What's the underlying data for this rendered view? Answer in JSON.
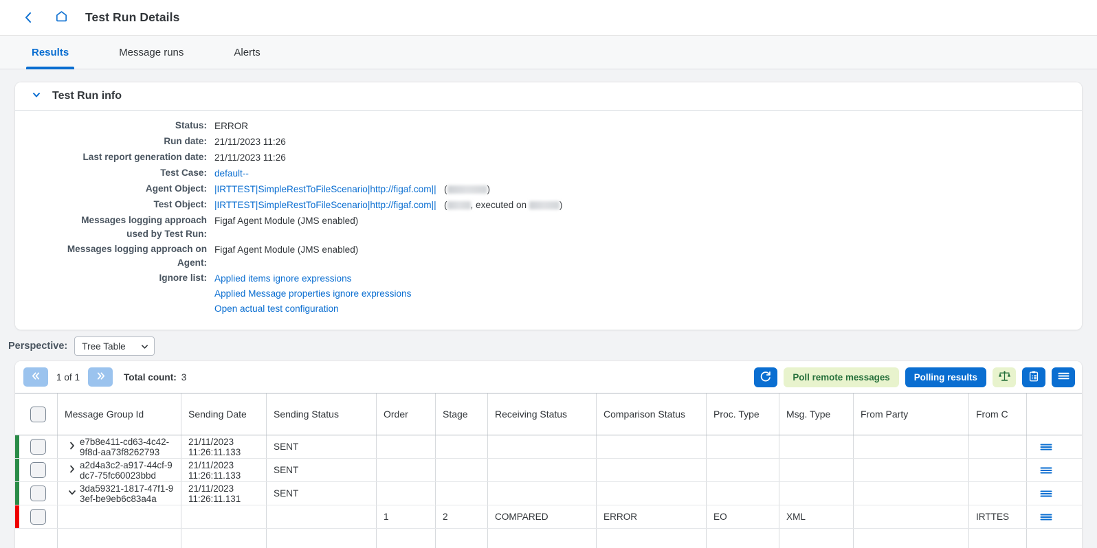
{
  "header": {
    "back_icon": "chevron-left-icon",
    "home_icon": "home-icon",
    "title": "Test Run Details"
  },
  "tabs": [
    {
      "label": "Results",
      "active": true
    },
    {
      "label": "Message runs",
      "active": false
    },
    {
      "label": "Alerts",
      "active": false
    }
  ],
  "info_panel": {
    "title": "Test Run info",
    "expanded": true,
    "rows": [
      {
        "label": "Status:",
        "value": "ERROR",
        "type": "text"
      },
      {
        "label": "Run date:",
        "value": "21/11/2023 11:26",
        "type": "text"
      },
      {
        "label": "Last report generation date:",
        "value": "21/11/2023 11:26",
        "type": "text"
      },
      {
        "label": "Test Case:",
        "value": "default--",
        "type": "link"
      },
      {
        "label": "Agent Object:",
        "value": "|IRTTEST|SimpleRestToFileScenario|http://figaf.com||",
        "type": "link-redacted",
        "suffix_open": "(",
        "suffix_close": ")"
      },
      {
        "label": "Test Object:",
        "value": "|IRTTEST|SimpleRestToFileScenario|http://figaf.com||",
        "type": "link-redacted-executed",
        "suffix_open": "(",
        "suffix_mid": ", executed on",
        "suffix_close": ")"
      },
      {
        "label": "Messages logging approach\nused by Test Run:",
        "value": "Figaf Agent Module (JMS enabled)",
        "type": "text"
      },
      {
        "label": "Messages logging approach on\nAgent:",
        "value": "Figaf Agent Module (JMS enabled)",
        "type": "text"
      },
      {
        "label": "Ignore list:",
        "type": "links",
        "links": [
          "Applied items ignore expressions",
          "Applied Message properties ignore expressions",
          "Open actual test configuration"
        ]
      }
    ]
  },
  "perspective": {
    "label": "Perspective:",
    "selected": "Tree Table",
    "caret_icon": "chevron-down-icon"
  },
  "table_toolbar": {
    "prev_icon": "double-chevron-left-icon",
    "next_icon": "double-chevron-right-icon",
    "page_text": "1 of 1",
    "total_label": "Total count:",
    "total_value": "3",
    "refresh_icon": "refresh-icon",
    "poll_remote_label": "Poll remote messages",
    "polling_results_label": "Polling results",
    "compare_icon": "scales-balance-icon",
    "clipboard_icon": "clipboard-list-icon",
    "menu_icon": "hamburger-menu-icon"
  },
  "table": {
    "columns": [
      "Message Group Id",
      "Sending Date",
      "Sending Status",
      "Order",
      "Stage",
      "Receiving Status",
      "Comparison Status",
      "Proc. Type",
      "Msg. Type",
      "From Party",
      "From C"
    ],
    "rows": [
      {
        "status_color": "#2a8b47",
        "expanded": false,
        "expander_icon": "chevron-right-icon",
        "group_id": "e7b8e411-cd63-4c42-9f8d-aa73f8262793",
        "sending_date": "21/11/2023 11:26:11.133",
        "sending_status": "SENT",
        "order": "",
        "stage": "",
        "receiving_status": "",
        "comparison_status": "",
        "proc_type": "",
        "msg_type": "",
        "from_party": "",
        "from_component": "",
        "menu_icon": "row-menu-icon"
      },
      {
        "status_color": "#2a8b47",
        "expanded": false,
        "expander_icon": "chevron-right-icon",
        "group_id": "a2d4a3c2-a917-44cf-9dc7-75fc60023bbd",
        "sending_date": "21/11/2023 11:26:11.133",
        "sending_status": "SENT",
        "order": "",
        "stage": "",
        "receiving_status": "",
        "comparison_status": "",
        "proc_type": "",
        "msg_type": "",
        "from_party": "",
        "from_component": "",
        "menu_icon": "row-menu-icon"
      },
      {
        "status_color": "#2a8b47",
        "expanded": true,
        "expander_icon": "chevron-down-icon",
        "group_id": "3da59321-1817-47f1-93ef-be9eb6c83a4a",
        "sending_date": "21/11/2023 11:26:11.131",
        "sending_status": "SENT",
        "order": "",
        "stage": "",
        "receiving_status": "",
        "comparison_status": "",
        "proc_type": "",
        "msg_type": "",
        "from_party": "",
        "from_component": "",
        "menu_icon": "row-menu-icon"
      },
      {
        "status_color": "#ee0000",
        "expanded": false,
        "expander_icon": "",
        "group_id": "",
        "sending_date": "",
        "sending_status": "",
        "order": "1",
        "stage": "2",
        "receiving_status": "COMPARED",
        "comparison_status": "ERROR",
        "proc_type": "EO",
        "msg_type": "XML",
        "from_party": "",
        "from_component": "IRTTES",
        "menu_icon": "row-menu-icon"
      }
    ]
  },
  "colors": {
    "accent_blue": "#0a6ed1",
    "status_green": "#2a8b47",
    "status_red": "#ee0000",
    "ghost_green_bg": "#e8f3cd",
    "ghost_green_fg": "#256f3a",
    "page_bg": "#f2f3f5"
  }
}
